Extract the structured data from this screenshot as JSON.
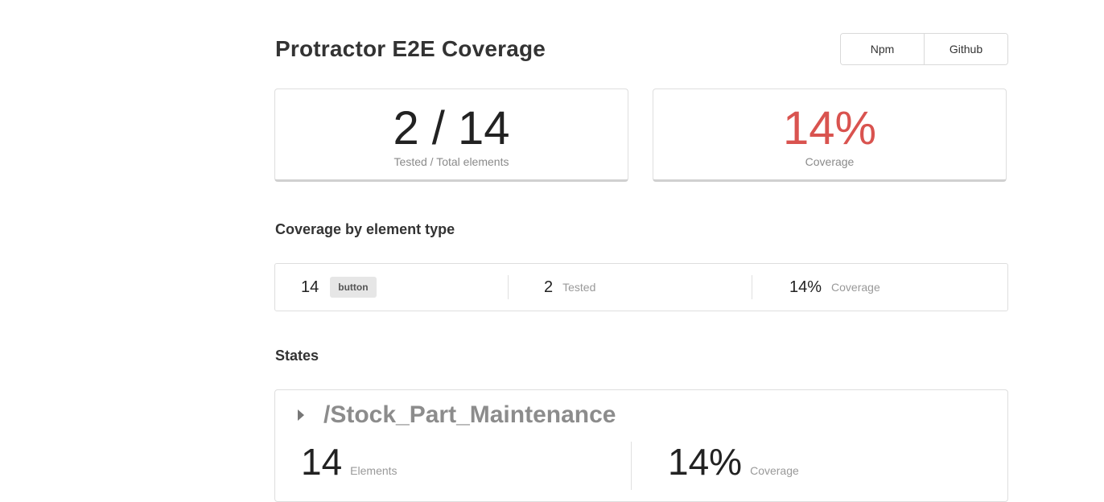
{
  "header": {
    "title": "Protractor E2E Coverage",
    "links": {
      "npm_label": "Npm",
      "github_label": "Github"
    }
  },
  "summary": {
    "tested_total": "2 / 14",
    "tested_total_caption": "Tested / Total elements",
    "coverage": "14%",
    "coverage_caption": "Coverage",
    "coverage_color": "#d9534f"
  },
  "by_type": {
    "heading": "Coverage by element type",
    "rows": [
      {
        "count": "14",
        "type": "button",
        "tested": "2",
        "tested_label": "Tested",
        "coverage": "14%",
        "coverage_label": "Coverage"
      }
    ]
  },
  "states": {
    "heading": "States",
    "items": [
      {
        "name": "/Stock_Part_Maintenance",
        "elements": "14",
        "elements_label": "Elements",
        "coverage": "14%",
        "coverage_label": "Coverage",
        "expand_icon": "caret-right-icon"
      }
    ]
  }
}
